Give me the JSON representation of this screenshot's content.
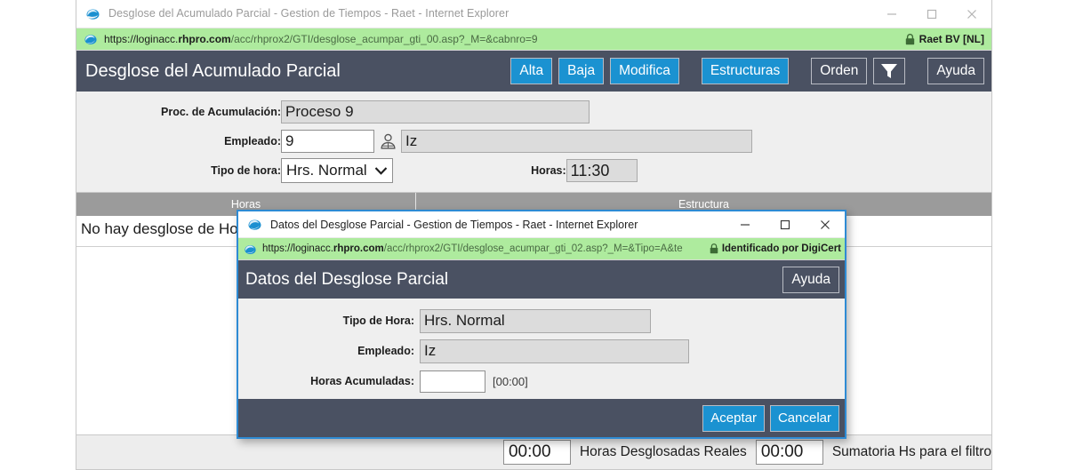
{
  "browser": {
    "title": "Desglose del Acumulado Parcial - Gestion de Tiempos - Raet - Internet Explorer",
    "url_scheme": "https://loginacc.",
    "url_domain": "rhpro.com",
    "url_path": "/acc/rhprox2/GTI/desglose_acumpar_gti_00.asp?_M=&cabnro=9",
    "identity": "Raet BV [NL]",
    "minimize_label": "Minimizar",
    "maximize_label": "Maximizar",
    "close_label": "Cerrar"
  },
  "app": {
    "title": "Desglose del Acumulado Parcial",
    "toolbar": {
      "alta": "Alta",
      "baja": "Baja",
      "modifica": "Modifica",
      "estructuras": "Estructuras",
      "orden": "Orden",
      "filtro": "Filtro",
      "ayuda": "Ayuda"
    },
    "accent_blue": "#1b92d1",
    "header_bg": "#4a5162"
  },
  "form": {
    "proceso_label": "Proc. de Acumulación:",
    "proceso_value": "Proceso 9",
    "empleado_label": "Empleado:",
    "empleado_code": "9",
    "empleado_name": "Iz",
    "tipo_hora_label": "Tipo de hora:",
    "tipo_hora_value": "Hrs. Normal",
    "horas_label": "Horas:",
    "horas_value": "11:30"
  },
  "table": {
    "col_horas": "Horas",
    "col_estructura": "Estructura",
    "empty_message": "No hay desglose de Hor"
  },
  "bottom": {
    "field_one": "00:00",
    "label_one": "Horas Desglosadas Reales",
    "field_two": "00:00",
    "label_two": "Sumatoria Hs para el filtro"
  },
  "modal": {
    "window_title": "Datos del Desglose Parcial - Gestion de Tiempos - Raet - Internet Explorer",
    "url_scheme": "https://loginacc.",
    "url_domain": "rhpro.com",
    "url_path": "/acc/rhprox2/GTI/desglose_acumpar_gti_02.asp?_M=&Tipo=A&te",
    "identity": "Identificado por DigiCert",
    "header_title": "Datos del Desglose Parcial",
    "ayuda": "Ayuda",
    "tipo_hora_label": "Tipo de Hora:",
    "tipo_hora_value": "Hrs. Normal",
    "empleado_label": "Empleado:",
    "empleado_value": "Iz",
    "horas_acum_label": "Horas Acumuladas:",
    "horas_acum_value": "",
    "horas_acum_hint": "[00:00]",
    "aceptar": "Aceptar",
    "cancelar": "Cancelar",
    "border_color": "#2e8bd4"
  }
}
